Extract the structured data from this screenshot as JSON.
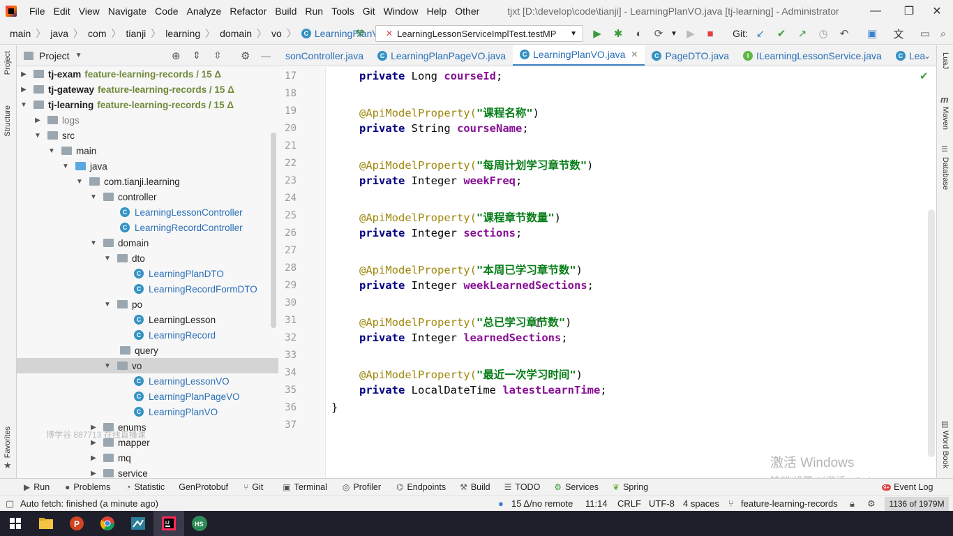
{
  "titlebar": {
    "menu": [
      "File",
      "Edit",
      "View",
      "Navigate",
      "Code",
      "Analyze",
      "Refactor",
      "Build",
      "Run",
      "Tools",
      "Git",
      "Window",
      "Help",
      "Other"
    ],
    "window_title": "tjxt [D:\\develop\\code\\tianji] - LearningPlanVO.java [tj-learning] - Administrator",
    "minimize": "—",
    "maximize": "❐",
    "close": "✕"
  },
  "navbar": {
    "breadcrumbs": [
      "main",
      "java",
      "com",
      "tianji",
      "learning",
      "domain",
      "vo",
      "LearningPlanVO"
    ],
    "run_config": "LearningLessonServiceImplTest.testMP",
    "git_label": "Git:"
  },
  "left_stripe": {
    "project": "Project",
    "structure": "Structure",
    "favorites": "Favorites"
  },
  "right_stripe": {
    "luaj": "LuaJ",
    "maven": "Maven",
    "database": "Database",
    "wordbook": "Word Book"
  },
  "project_panel": {
    "title": "Project",
    "tree": [
      {
        "label": "tj-exam",
        "branch": "feature-learning-records / 15 Δ"
      },
      {
        "label": "tj-gateway",
        "branch": "feature-learning-records / 15 Δ"
      },
      {
        "label": "tj-learning",
        "branch": "feature-learning-records / 15 Δ"
      },
      {
        "label": "logs"
      },
      {
        "label": "src"
      },
      {
        "label": "main"
      },
      {
        "label": "java"
      },
      {
        "label": "com.tianji.learning"
      },
      {
        "label": "controller"
      },
      {
        "label": "LearningLessonController"
      },
      {
        "label": "LearningRecordController"
      },
      {
        "label": "domain"
      },
      {
        "label": "dto"
      },
      {
        "label": "LearningPlanDTO"
      },
      {
        "label": "LearningRecordFormDTO"
      },
      {
        "label": "po"
      },
      {
        "label": "LearningLesson"
      },
      {
        "label": "LearningRecord"
      },
      {
        "label": "query"
      },
      {
        "label": "vo"
      },
      {
        "label": "LearningLessonVO"
      },
      {
        "label": "LearningPlanPageVO"
      },
      {
        "label": "LearningPlanVO"
      },
      {
        "label": "enums"
      },
      {
        "label": "mapper"
      },
      {
        "label": "mq"
      },
      {
        "label": "service"
      }
    ],
    "overlay_watermark": "博学谷 887713 在线直播课"
  },
  "editor": {
    "tabs": [
      {
        "label": "sonController.java",
        "active": false
      },
      {
        "label": "LearningPlanPageVO.java",
        "active": false
      },
      {
        "label": "LearningPlanVO.java",
        "active": true
      },
      {
        "label": "PageDTO.java",
        "active": false
      },
      {
        "label": "ILearningLessonService.java",
        "active": false
      },
      {
        "label": "Lea",
        "active": false
      }
    ],
    "line_numbers": [
      "17",
      "18",
      "19",
      "20",
      "21",
      "22",
      "23",
      "24",
      "25",
      "26",
      "27",
      "28",
      "29",
      "30",
      "31",
      "32",
      "33",
      "34",
      "35",
      "36",
      "37"
    ],
    "code": {
      "l17": {
        "kw": "private",
        "type": "Long",
        "field": "courseId",
        "end": ";"
      },
      "l19": {
        "ann": "@ApiModelProperty(",
        "str": "\"课程名称\"",
        "end": ")"
      },
      "l20": {
        "kw": "private",
        "type": "String",
        "field": "courseName",
        "end": ";"
      },
      "l22": {
        "ann": "@ApiModelProperty(",
        "str": "\"每周计划学习章节数\"",
        "end": ")"
      },
      "l23": {
        "kw": "private",
        "type": "Integer",
        "field": "weekFreq",
        "end": ";"
      },
      "l25": {
        "ann": "@ApiModelProperty(",
        "str": "\"课程章节数量\"",
        "end": ")"
      },
      "l26": {
        "kw": "private",
        "type": "Integer",
        "field": "sections",
        "end": ";"
      },
      "l28": {
        "ann": "@ApiModelProperty(",
        "str": "\"本周已学习章节数\"",
        "end": ")"
      },
      "l29": {
        "kw": "private",
        "type": "Integer",
        "field": "weekLearnedSections",
        "end": ";"
      },
      "l31": {
        "ann": "@ApiModelProperty(",
        "str": "\"总已学习章节数\"",
        "end": ")"
      },
      "l32": {
        "kw": "private",
        "type": "Integer",
        "field": "learnedSections",
        "end": ";"
      },
      "l34": {
        "ann": "@ApiModelProperty(",
        "str": "\"最近一次学习时间\"",
        "end": ")"
      },
      "l35": {
        "kw": "private",
        "type": "LocalDateTime",
        "field": "latestLearnTime",
        "end": ";"
      },
      "l36": {
        "brace": "}"
      }
    }
  },
  "toolwindows": [
    "Run",
    "Problems",
    "Statistic",
    "GenProtobuf",
    "Git",
    "Terminal",
    "Profiler",
    "Endpoints",
    "Build",
    "TODO",
    "Services",
    "Spring",
    "Event Log"
  ],
  "event_log_badge": "9+",
  "statusbar": {
    "message": "Auto fetch: finished (a minute ago)",
    "vcs": "15 Δ/no remote",
    "position": "11:14",
    "line_sep": "CRLF",
    "encoding": "UTF-8",
    "indent": "4 spaces",
    "branch": "feature-learning-records",
    "memory": "1136 of 1979M"
  },
  "activation_watermark": {
    "line1": "激活 Windows",
    "line2": "转到\"设置\"以激活 Windows。"
  },
  "taskbar": {
    "apps": [
      "start",
      "file-explorer",
      "powerpoint",
      "chrome",
      "screenshot-tool",
      "intellij",
      "hs"
    ]
  },
  "colors": {
    "accent": "#4083c9",
    "keyword": "#0033b3",
    "string": "#067d17",
    "field": "#871094",
    "annotation": "#9e880d"
  }
}
